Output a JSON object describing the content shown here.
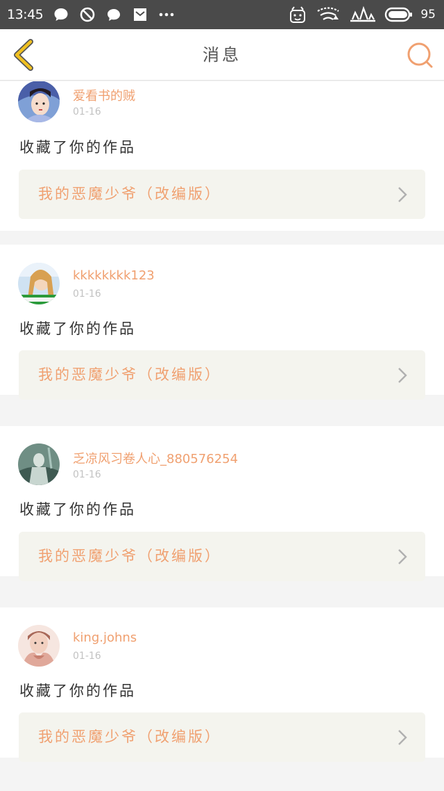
{
  "status_bar": {
    "time": "13:45",
    "battery": "95"
  },
  "header": {
    "title": "消息"
  },
  "colors": {
    "accent": "#f0a070",
    "back_arrow": "#f0c020",
    "status_bar_bg": "#4a4a4a",
    "card_link_bg": "#f4f4ee"
  },
  "messages": [
    {
      "username": "爱看书的贼",
      "time": "01-16",
      "action": "收藏了你的作品",
      "work_title": "我的恶魔少爷（改编版）"
    },
    {
      "username": "kkkkkkkk123",
      "time": "01-16",
      "action": "收藏了你的作品",
      "work_title": "我的恶魔少爷（改编版）"
    },
    {
      "username": "乏凉风习卷人心_880576254",
      "time": "01-16",
      "action": "收藏了你的作品",
      "work_title": "我的恶魔少爷（改编版）"
    },
    {
      "username": "king.johns",
      "time": "01-16",
      "action": "收藏了你的作品",
      "work_title": "我的恶魔少爷（改编版）"
    }
  ]
}
